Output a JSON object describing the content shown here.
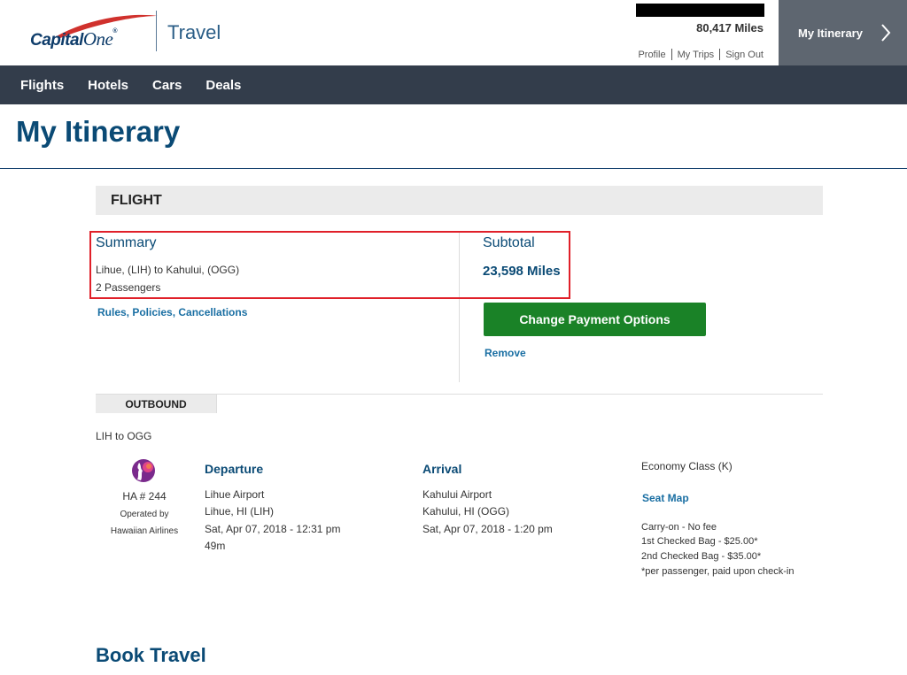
{
  "header": {
    "brand": "Capital",
    "brand_one": "One",
    "brand_reg": "®",
    "product": "Travel",
    "miles_balance": "80,417 Miles",
    "links": [
      "Profile",
      "My Trips",
      "Sign Out"
    ],
    "itinerary_button": "My Itinerary",
    "itinerary_chevron": "›"
  },
  "nav": {
    "items": [
      "Flights",
      "Hotels",
      "Cars",
      "Deals"
    ]
  },
  "page": {
    "title": "My Itinerary"
  },
  "flight": {
    "section_label": "FLIGHT",
    "summary": {
      "title": "Summary",
      "route": "Lihue, (LIH) to Kahului, (OGG)",
      "passengers": "2 Passengers",
      "rules_link": "Rules, Policies, Cancellations"
    },
    "subtotal": {
      "title": "Subtotal",
      "value": "23,598 Miles",
      "change_payment_button": "Change Payment Options",
      "remove_link": "Remove"
    },
    "outbound": {
      "tab_label": "OUTBOUND",
      "route": "LIH to OGG",
      "flight_number": "HA # 244",
      "operated_by_label": "Operated by",
      "operator": "Hawaiian Airlines",
      "departure": {
        "title": "Departure",
        "airport": "Lihue Airport",
        "city": "Lihue, HI (LIH)",
        "datetime": "Sat, Apr 07, 2018 - 12:31 pm",
        "duration": "49m"
      },
      "arrival": {
        "title": "Arrival",
        "airport": "Kahului Airport",
        "city": "Kahului, HI (OGG)",
        "datetime": "Sat, Apr 07, 2018 - 1:20 pm"
      },
      "cabin_class": "Economy Class (K)",
      "seat_map_link": "Seat Map",
      "baggage": [
        "Carry-on - No fee",
        "1st Checked Bag - $25.00*",
        "2nd Checked Bag - $35.00*",
        "*per passenger, paid upon check-in"
      ]
    }
  },
  "book_travel": {
    "title": "Book Travel"
  },
  "colors": {
    "nav_bg": "#333d4b",
    "itinerary_button_bg": "#5e6670",
    "heading_blue": "#0a4a75",
    "link_blue": "#1a6fa3",
    "button_green": "#1a8227",
    "highlight_red": "#e02029",
    "logo_red": "#d0312d"
  }
}
